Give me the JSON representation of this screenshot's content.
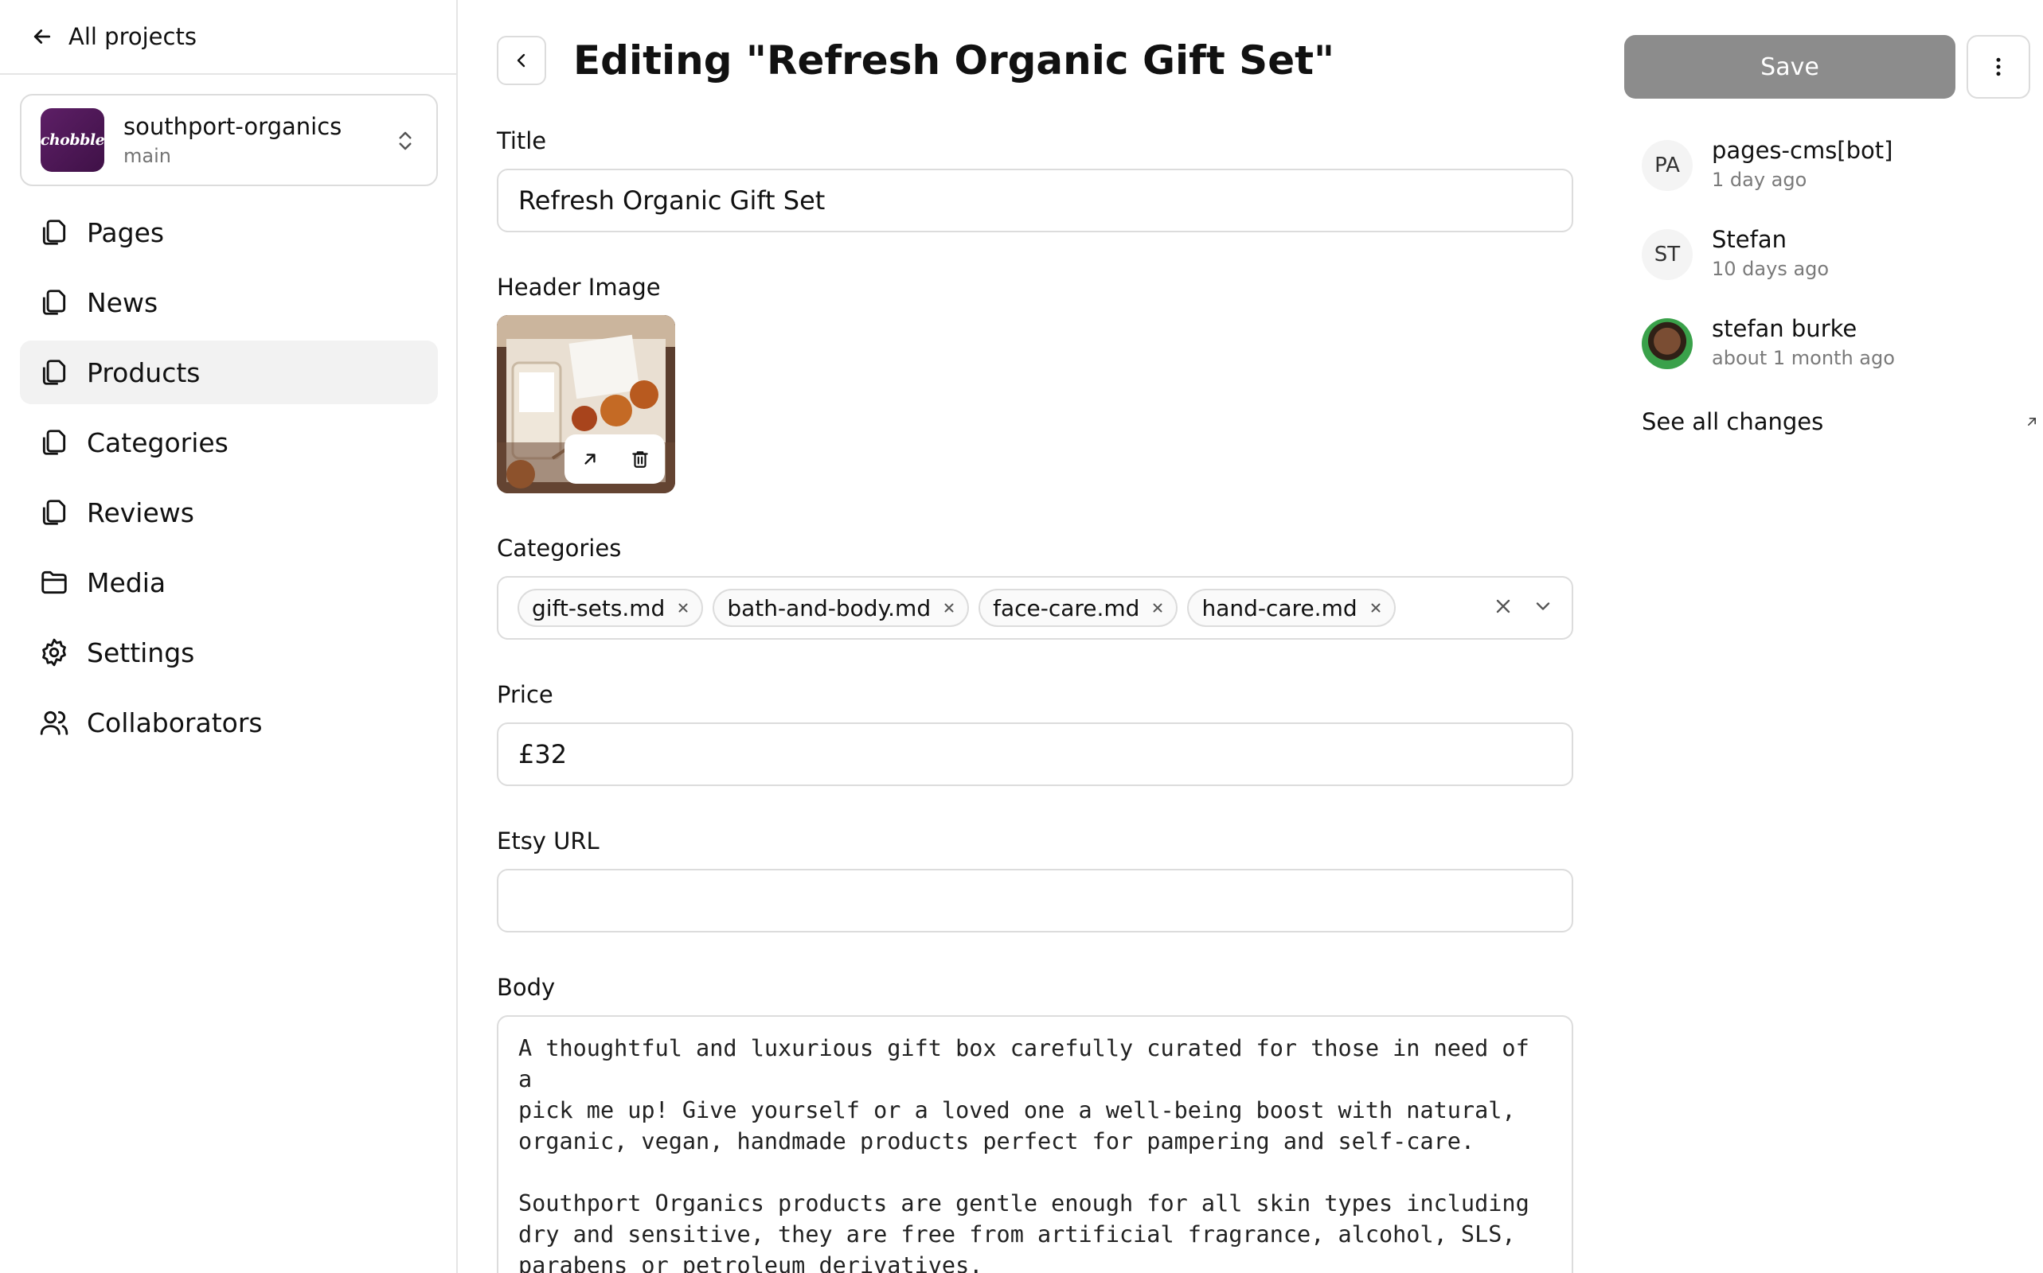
{
  "sidebar": {
    "back_label": "All projects",
    "project": {
      "name": "southport-organics",
      "branch": "main",
      "logo_text": "chobble"
    },
    "items": [
      {
        "label": "Pages",
        "icon": "files-icon",
        "active": false
      },
      {
        "label": "News",
        "icon": "files-icon",
        "active": false
      },
      {
        "label": "Products",
        "icon": "files-icon",
        "active": true
      },
      {
        "label": "Categories",
        "icon": "files-icon",
        "active": false
      },
      {
        "label": "Reviews",
        "icon": "files-icon",
        "active": false
      },
      {
        "label": "Media",
        "icon": "folder-icon",
        "active": false
      },
      {
        "label": "Settings",
        "icon": "gear-icon",
        "active": false
      },
      {
        "label": "Collaborators",
        "icon": "users-icon",
        "active": false
      }
    ]
  },
  "main": {
    "title": "Editing \"Refresh Organic Gift Set\"",
    "fields": {
      "title": {
        "label": "Title",
        "value": "Refresh Organic Gift Set"
      },
      "header_image": {
        "label": "Header Image"
      },
      "categories": {
        "label": "Categories",
        "chips": [
          "gift-sets.md",
          "bath-and-body.md",
          "face-care.md",
          "hand-care.md"
        ]
      },
      "price": {
        "label": "Price",
        "value": "£32"
      },
      "etsy_url": {
        "label": "Etsy URL",
        "value": ""
      },
      "body": {
        "label": "Body",
        "value": "A thoughtful and luxurious gift box carefully curated for those in need of a\npick me up! Give yourself or a loved one a well-being boost with natural,\norganic, vegan, handmade products perfect for pampering and self-care.\n\nSouthport Organics products are gentle enough for all skin types including\ndry and sensitive, they are free from artificial fragrance, alcohol, SLS,\nparabens or petroleum derivatives."
      }
    }
  },
  "right": {
    "save_label": "Save",
    "history": [
      {
        "initials": "PA",
        "name": "pages-cms[bot]",
        "time": "1 day ago"
      },
      {
        "initials": "ST",
        "name": "Stefan",
        "time": "10 days ago"
      },
      {
        "initials": "",
        "name": "stefan burke",
        "time": "about 1 month ago"
      }
    ],
    "see_all_label": "See all changes"
  },
  "colors": {
    "save_button": "#8c8c8c",
    "active_nav": "#f2f2f2",
    "border": "#dcdcdc",
    "logo": "#4a1553"
  }
}
